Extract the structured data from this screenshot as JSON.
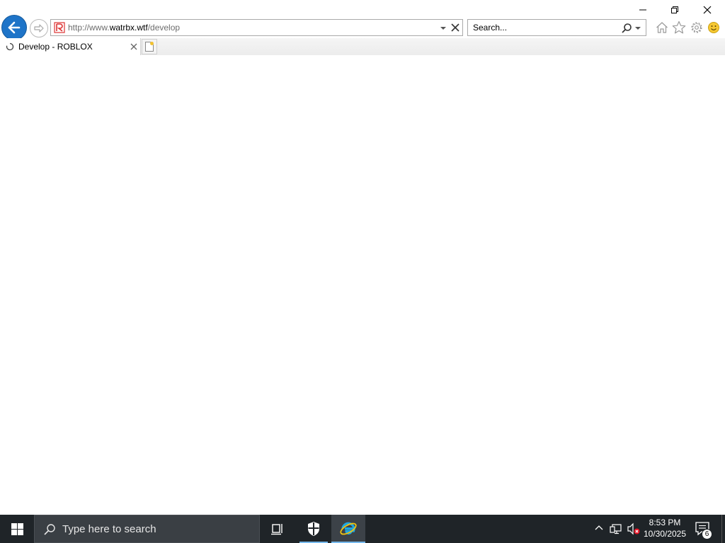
{
  "browser": {
    "address": {
      "prefix": "http://www.",
      "domain": "watrbx.wtf",
      "path": "/develop"
    },
    "search": {
      "placeholder": "Search..."
    },
    "tabs": [
      {
        "title": "Develop - ROBLOX",
        "active": true
      }
    ]
  },
  "taskbar": {
    "search_placeholder": "Type here to search",
    "clock": {
      "time": "8:53 PM",
      "date": "10/30/2025"
    },
    "notification_count": "6"
  },
  "colors": {
    "back_button": "#1e74c8",
    "taskbar": "#1f2428",
    "ie_accent": "#1ea7e1"
  }
}
